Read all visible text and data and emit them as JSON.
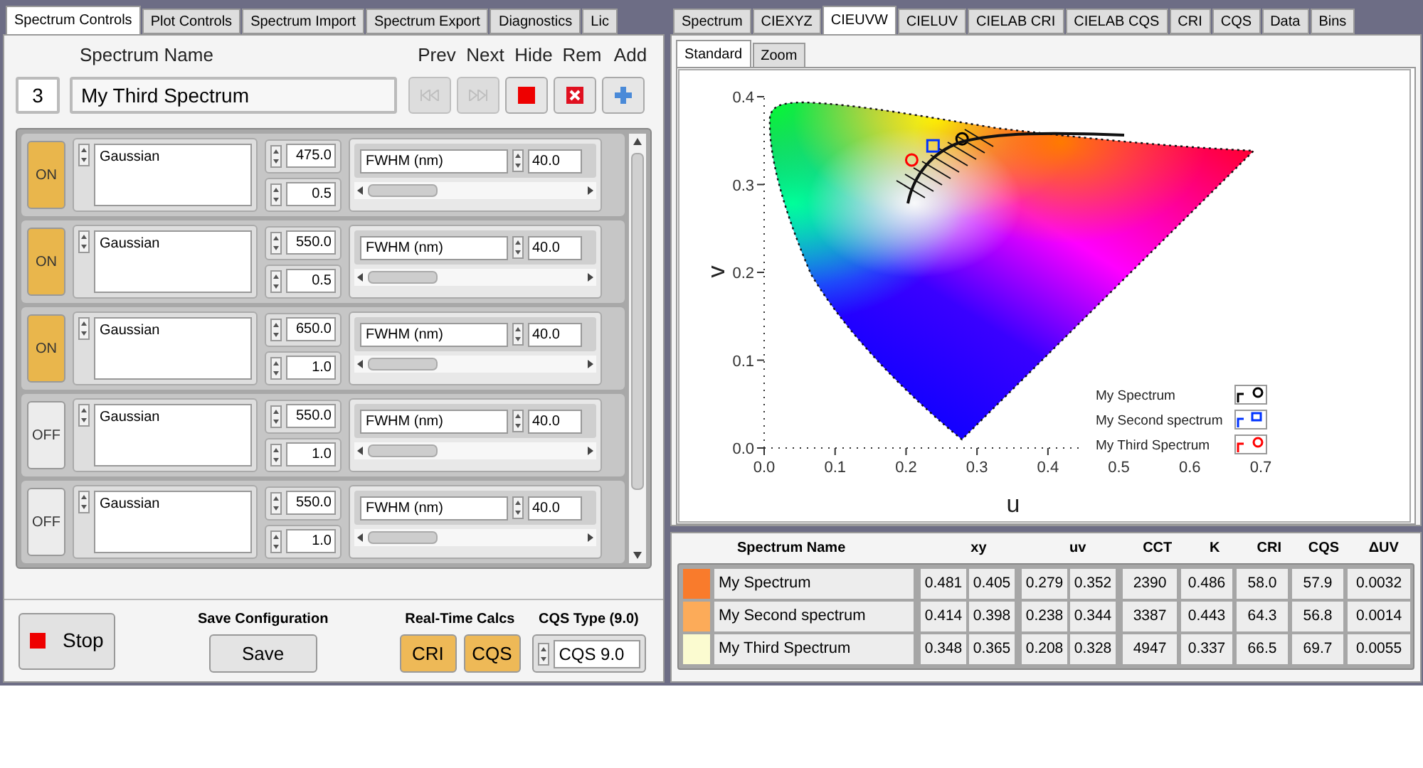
{
  "left_panel": {
    "tabs": [
      {
        "label": "Spectrum Controls",
        "selected": true
      },
      {
        "label": "Plot Controls",
        "selected": false
      },
      {
        "label": "Spectrum Import",
        "selected": false
      },
      {
        "label": "Spectrum Export",
        "selected": false
      },
      {
        "label": "Diagnostics",
        "selected": false
      },
      {
        "label": "Lic",
        "selected": false
      }
    ],
    "index": "3",
    "name_label": "Spectrum Name",
    "name_value": "My Third Spectrum",
    "nav_buttons": [
      {
        "label": "Prev",
        "kind": "prev",
        "disabled": true
      },
      {
        "label": "Next",
        "kind": "next",
        "disabled": true
      },
      {
        "label": "Hide",
        "kind": "hide",
        "disabled": false
      },
      {
        "label": "Rem",
        "kind": "remove",
        "disabled": false
      },
      {
        "label": "Add",
        "kind": "add",
        "disabled": false
      }
    ],
    "components": [
      {
        "on": true,
        "toggle": "ON",
        "type": "Gaussian",
        "center": "475.0",
        "amplitude": "0.5",
        "param_label": "FWHM (nm)",
        "param_value": "40.0"
      },
      {
        "on": true,
        "toggle": "ON",
        "type": "Gaussian",
        "center": "550.0",
        "amplitude": "0.5",
        "param_label": "FWHM (nm)",
        "param_value": "40.0"
      },
      {
        "on": true,
        "toggle": "ON",
        "type": "Gaussian",
        "center": "650.0",
        "amplitude": "1.0",
        "param_label": "FWHM (nm)",
        "param_value": "40.0"
      },
      {
        "on": false,
        "toggle": "OFF",
        "type": "Gaussian",
        "center": "550.0",
        "amplitude": "1.0",
        "param_label": "FWHM (nm)",
        "param_value": "40.0"
      },
      {
        "on": false,
        "toggle": "OFF",
        "type": "Gaussian",
        "center": "550.0",
        "amplitude": "1.0",
        "param_label": "FWHM (nm)",
        "param_value": "40.0"
      }
    ],
    "stop_button": "Stop",
    "save_config": {
      "title": "Save Configuration",
      "button": "Save"
    },
    "realtime": {
      "title": "Real-Time Calcs",
      "buttons": [
        {
          "label": "CRI",
          "on": true
        },
        {
          "label": "CQS",
          "on": true
        }
      ]
    },
    "cqs_type": {
      "title": "CQS Type (9.0)",
      "value": "CQS 9.0"
    }
  },
  "right_panel": {
    "tabs": [
      {
        "label": "Spectrum",
        "selected": false
      },
      {
        "label": "CIEXYZ",
        "selected": false
      },
      {
        "label": "CIEUVW",
        "selected": true
      },
      {
        "label": "CIELUV",
        "selected": false
      },
      {
        "label": "CIELAB CRI",
        "selected": false
      },
      {
        "label": "CIELAB CQS",
        "selected": false
      },
      {
        "label": "CRI",
        "selected": false
      },
      {
        "label": "CQS",
        "selected": false
      },
      {
        "label": "Data",
        "selected": false
      },
      {
        "label": "Bins",
        "selected": false
      }
    ],
    "subtabs": [
      {
        "label": "Standard",
        "selected": true
      },
      {
        "label": "Zoom",
        "selected": false
      }
    ],
    "chart_data": {
      "type": "scatter",
      "xlabel": "u",
      "ylabel": "v",
      "xlim": [
        0,
        0.7
      ],
      "ylim": [
        0,
        0.4
      ],
      "xticks": [
        {
          "value": 0,
          "label": "0.0"
        },
        {
          "value": 0.1,
          "label": "0.1"
        },
        {
          "value": 0.2,
          "label": "0.2"
        },
        {
          "value": 0.3,
          "label": "0.3"
        },
        {
          "value": 0.4,
          "label": "0.4"
        },
        {
          "value": 0.5,
          "label": "0.5"
        },
        {
          "value": 0.6,
          "label": "0.6"
        },
        {
          "value": 0.7,
          "label": "0.7"
        }
      ],
      "yticks": [
        {
          "value": 0,
          "label": "0.0"
        },
        {
          "value": 0.1,
          "label": "0.1"
        },
        {
          "value": 0.2,
          "label": "0.2"
        },
        {
          "value": 0.3,
          "label": "0.3"
        },
        {
          "value": 0.4,
          "label": "0.4"
        }
      ],
      "series": [
        {
          "name": "My Spectrum",
          "color": "#000000",
          "marker": "circle",
          "x": [
            0.279
          ],
          "values": [
            0.352
          ]
        },
        {
          "name": "My Second spectrum",
          "color": "#0033ff",
          "marker": "square",
          "x": [
            0.238
          ],
          "values": [
            0.344
          ]
        },
        {
          "name": "My Third Spectrum",
          "color": "#ff0000",
          "marker": "circle",
          "x": [
            0.208
          ],
          "values": [
            0.328
          ]
        }
      ]
    },
    "table": {
      "columns": [
        "Spectrum Name",
        "xy",
        "uv",
        "CCT",
        "K",
        "CRI",
        "CQS",
        "ΔUV"
      ],
      "rows": [
        {
          "color": "#f97b2c",
          "name": "My Spectrum",
          "xy": [
            "0.481",
            "0.405"
          ],
          "uv": [
            "0.279",
            "0.352"
          ],
          "cct": "2390",
          "k": "0.486",
          "cri": "58.0",
          "cqs": "57.9",
          "duv": "0.0032"
        },
        {
          "color": "#fcab59",
          "name": "My Second spectrum",
          "xy": [
            "0.414",
            "0.398"
          ],
          "uv": [
            "0.238",
            "0.344"
          ],
          "cct": "3387",
          "k": "0.443",
          "cri": "64.3",
          "cqs": "56.8",
          "duv": "0.0014"
        },
        {
          "color": "#fbfbd0",
          "name": "My Third Spectrum",
          "xy": [
            "0.348",
            "0.365"
          ],
          "uv": [
            "0.208",
            "0.328"
          ],
          "cct": "4947",
          "k": "0.337",
          "cri": "66.5",
          "cqs": "69.7",
          "duv": "0.0055"
        }
      ]
    }
  }
}
